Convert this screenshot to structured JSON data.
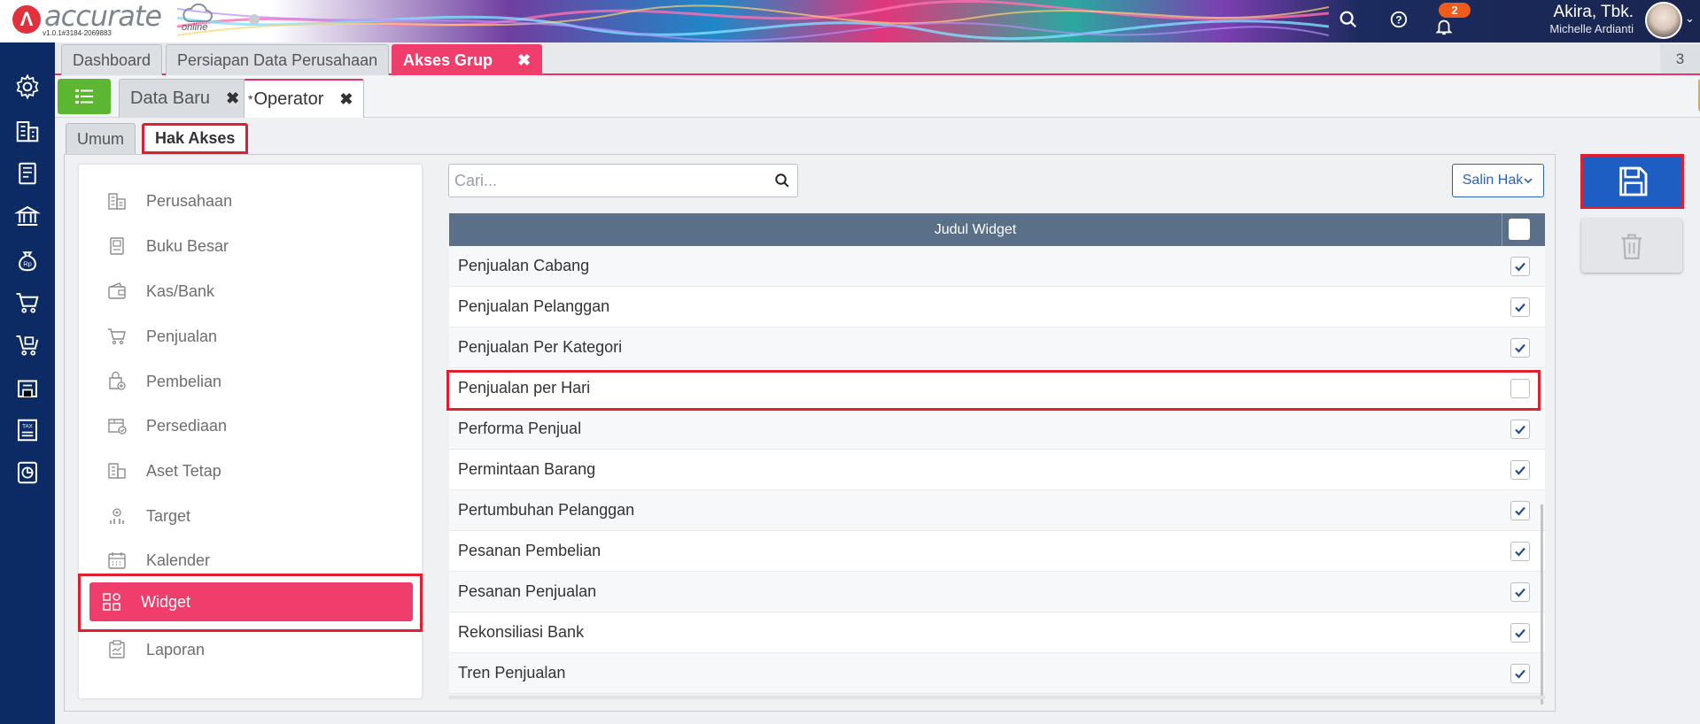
{
  "brand": {
    "name": "accurate",
    "online": "online",
    "version": "v1.0.1#3184-2069883"
  },
  "header": {
    "notifications_count": "2",
    "user_name": "Akira, Tbk.",
    "user_subtitle": "Michelle Ardianti"
  },
  "tabs_main": [
    {
      "label": "Dashboard"
    },
    {
      "label": "Persiapan Data Perusahaan"
    },
    {
      "label": "Akses Grup",
      "close": "✖"
    }
  ],
  "tabs_count": "3",
  "tabs_sub": [
    {
      "label": "Data Baru",
      "close": "✖"
    },
    {
      "label": "Operator",
      "modified_marker": "*",
      "close": "✖"
    }
  ],
  "form_tabs": {
    "umum": "Umum",
    "hak_akses": "Hak Akses"
  },
  "sidebar": {
    "items": [
      {
        "label": "Perusahaan",
        "icon": "company-icon"
      },
      {
        "label": "Buku Besar",
        "icon": "ledger-icon"
      },
      {
        "label": "Kas/Bank",
        "icon": "wallet-icon"
      },
      {
        "label": "Penjualan",
        "icon": "cart-icon"
      },
      {
        "label": "Pembelian",
        "icon": "purchase-bag-icon"
      },
      {
        "label": "Persediaan",
        "icon": "inventory-icon"
      },
      {
        "label": "Aset Tetap",
        "icon": "fixed-asset-icon"
      },
      {
        "label": "Target",
        "icon": "target-icon"
      },
      {
        "label": "Kalender",
        "icon": "calendar-icon"
      },
      {
        "label": "Widget",
        "icon": "widget-icon",
        "selected": true
      },
      {
        "label": "Laporan",
        "icon": "report-icon"
      }
    ]
  },
  "search": {
    "placeholder": "Cari...",
    "value": ""
  },
  "salin_hak": "Salin Hak",
  "table": {
    "header": "Judul Widget",
    "header_checked": false,
    "rows": [
      {
        "label": "Penjualan Cabang",
        "checked": true
      },
      {
        "label": "Penjualan Pelanggan",
        "checked": true
      },
      {
        "label": "Penjualan Per Kategori",
        "checked": true
      },
      {
        "label": "Penjualan per Hari",
        "checked": false,
        "highlighted": true
      },
      {
        "label": "Performa Penjual",
        "checked": true
      },
      {
        "label": "Permintaan Barang",
        "checked": true
      },
      {
        "label": "Pertumbuhan Pelanggan",
        "checked": true
      },
      {
        "label": "Pesanan Pembelian",
        "checked": true
      },
      {
        "label": "Pesanan Penjualan",
        "checked": true
      },
      {
        "label": "Rekonsiliasi Bank",
        "checked": true
      },
      {
        "label": "Tren Penjualan",
        "checked": true
      }
    ]
  },
  "colors": {
    "accent_pink": "#ef3e6c",
    "nav_blue": "#0c2a64",
    "save_blue": "#1e5dc1",
    "highlight_red": "#e0202e",
    "green": "#5cb632",
    "orange": "#f5a623"
  }
}
